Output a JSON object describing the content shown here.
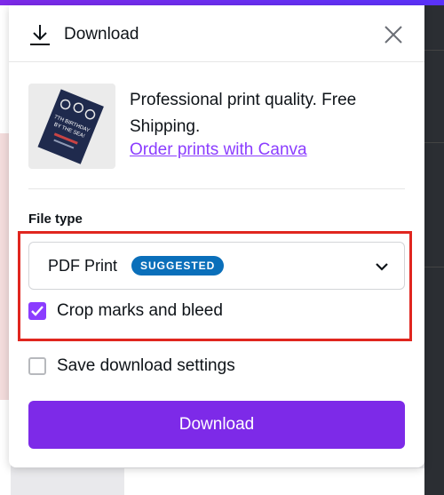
{
  "dialog": {
    "title": "Download",
    "download_icon": "download-icon",
    "close_icon": "close-icon"
  },
  "promo": {
    "thumbnail": {
      "icon": "print-flyer-thumbnail",
      "line1": "7TH BIRTHDAY",
      "line2": "BY THE SEA!"
    },
    "text": "Professional print quality. Free Shipping.",
    "link": "Order prints with Canva"
  },
  "file_type": {
    "label": "File type",
    "selected": "PDF Print",
    "badge": "SUGGESTED",
    "chevron_icon": "chevron-down-icon"
  },
  "options": [
    {
      "label": "Crop marks and bleed",
      "checked": true
    },
    {
      "label": "Save download settings",
      "checked": false
    }
  ],
  "download_button": "Download",
  "colors": {
    "accent": "#7d2ae8",
    "checkbox_accent": "#8b3dff",
    "link": "#8b3dff",
    "badge": "#0a6fba",
    "highlight": "#e0261f"
  }
}
